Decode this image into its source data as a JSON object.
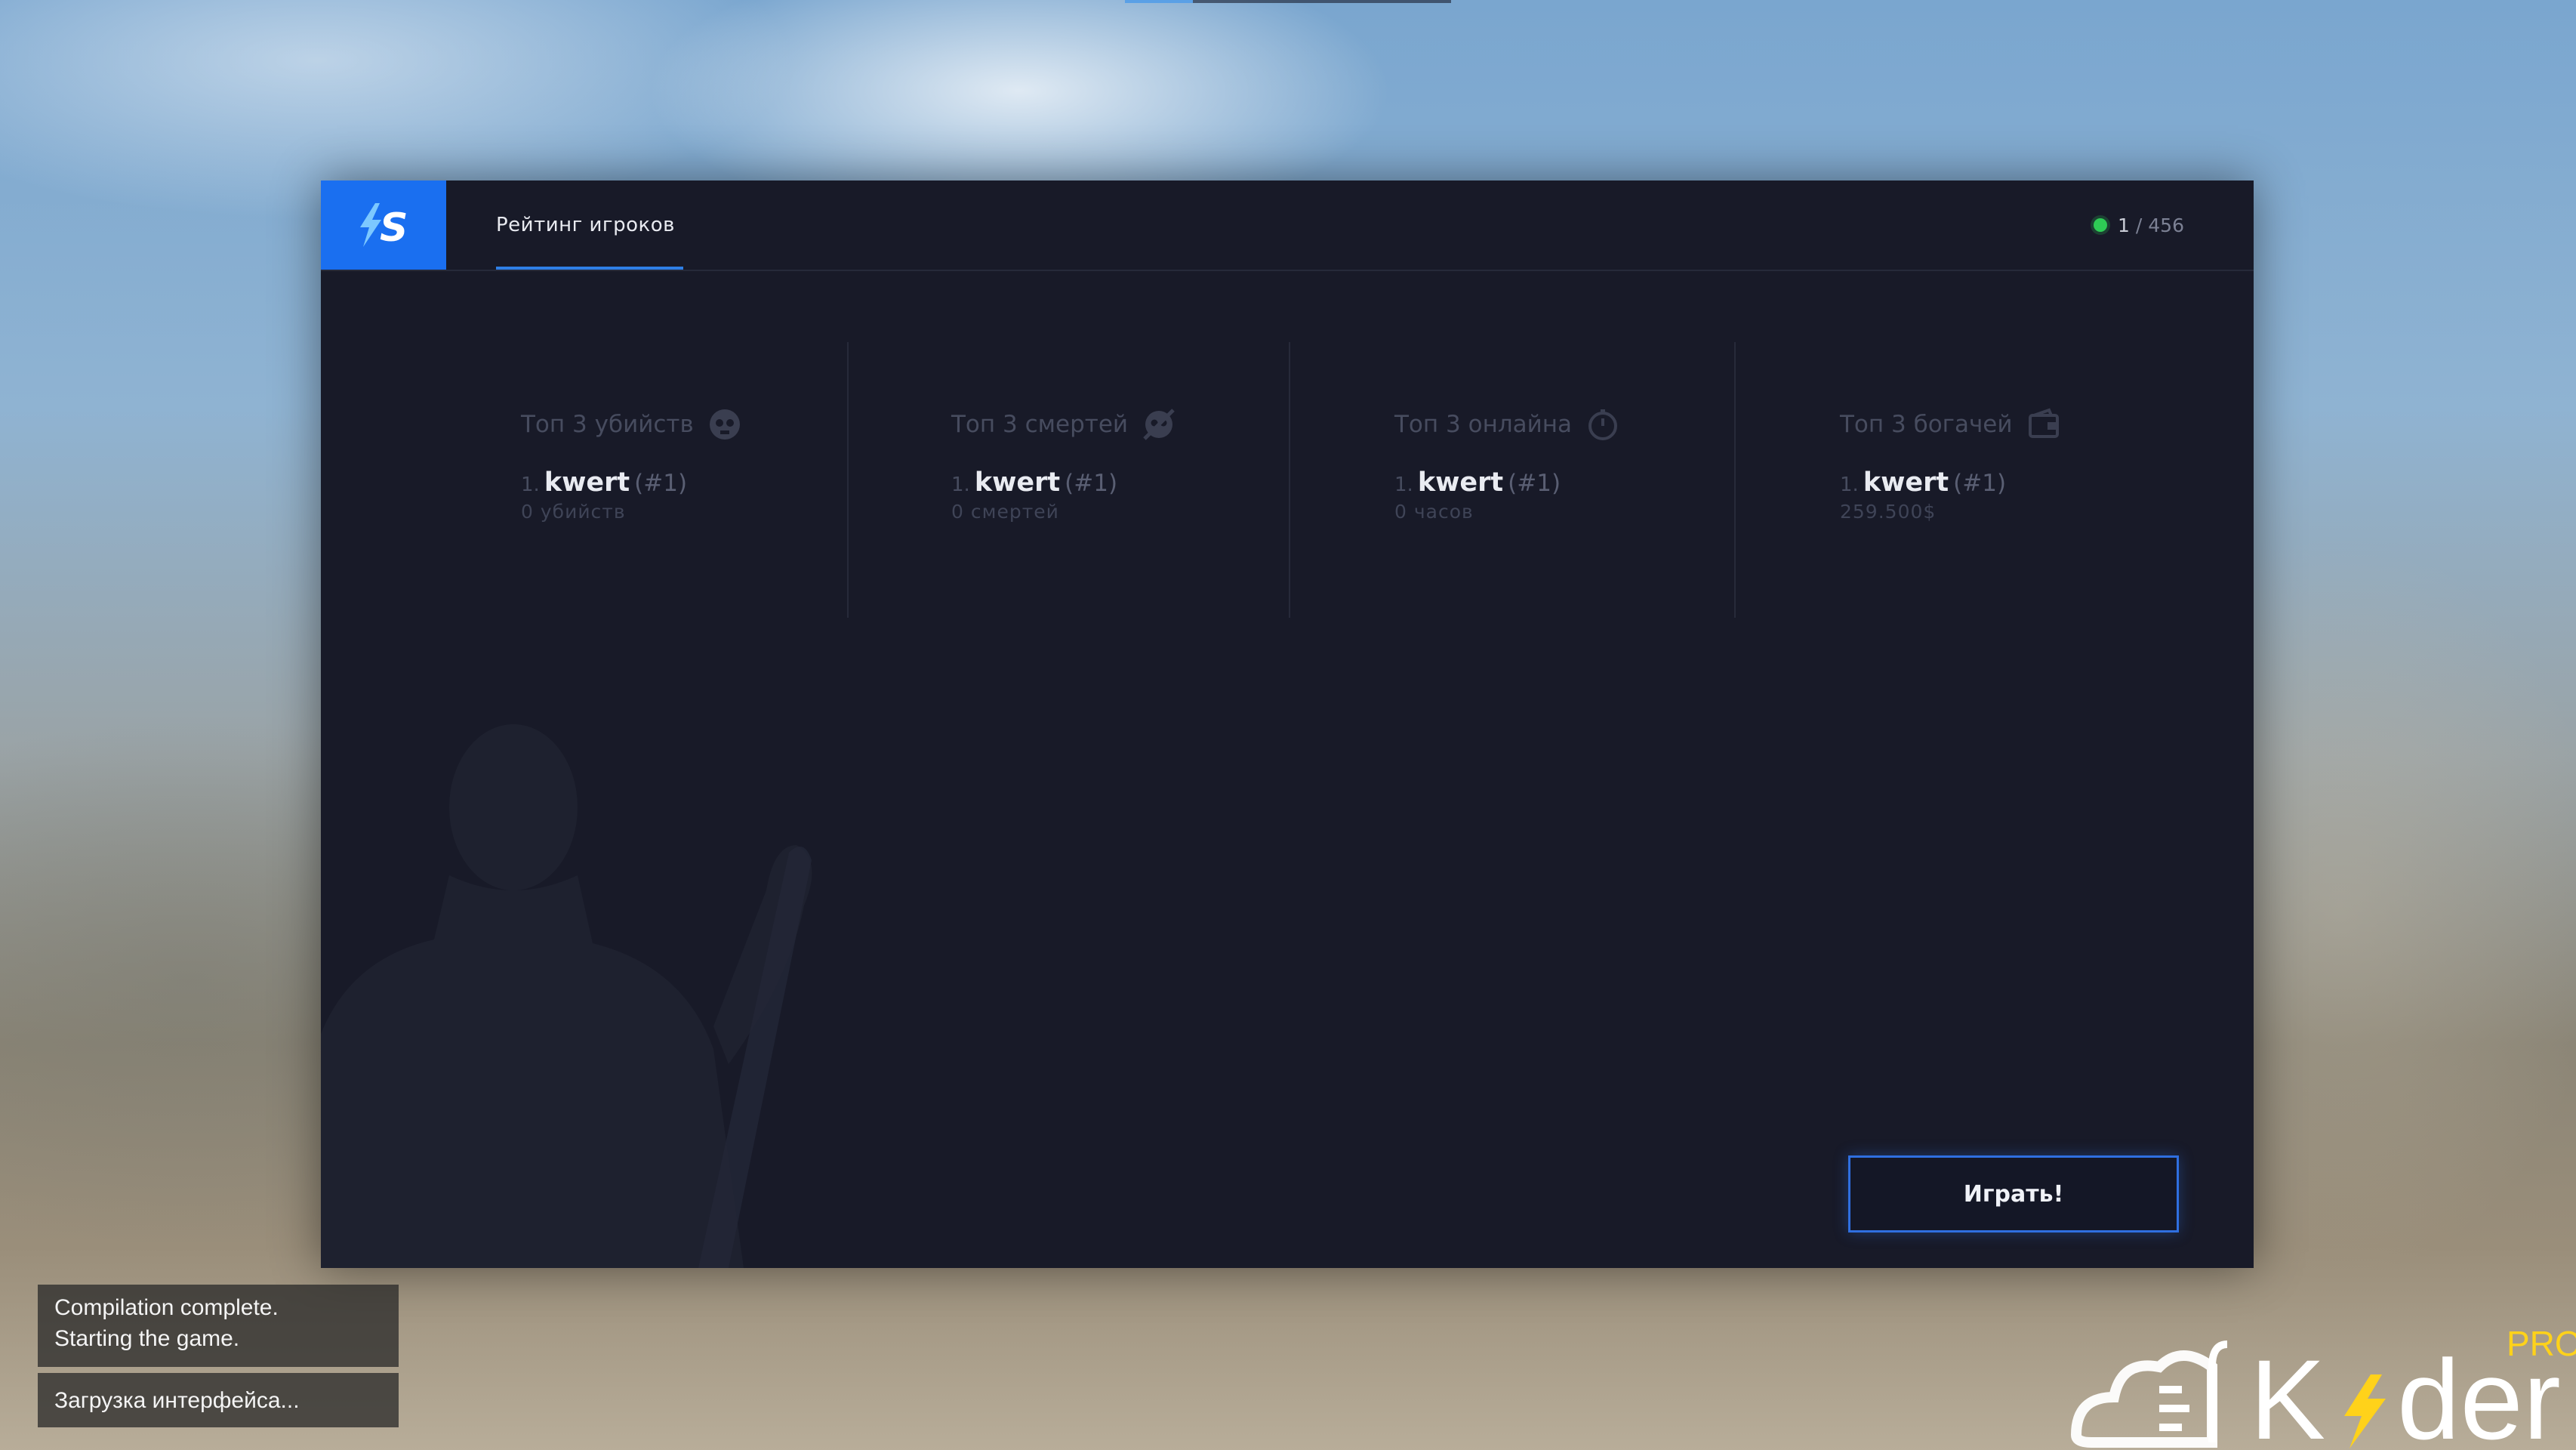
{
  "header": {
    "tab_label": "Рейтинг игроков",
    "online_current": "1",
    "online_separator": "/",
    "online_max": "456"
  },
  "stats": [
    {
      "title": "Топ 3 убийств",
      "icon": "skull-icon",
      "rank": "1.",
      "player": "kwert",
      "tag": "(#1)",
      "value": "0 убийств"
    },
    {
      "title": "Топ 3 смертей",
      "icon": "crossed-skull-icon",
      "rank": "1.",
      "player": "kwert",
      "tag": "(#1)",
      "value": "0 смертей"
    },
    {
      "title": "Топ 3 онлайна",
      "icon": "timer-icon",
      "rank": "1.",
      "player": "kwert",
      "tag": "(#1)",
      "value": "0 часов"
    },
    {
      "title": "Топ 3 богачей",
      "icon": "wallet-icon",
      "rank": "1.",
      "player": "kwert",
      "tag": "(#1)",
      "value": "259.500$"
    }
  ],
  "play_button": {
    "label": "Играть!"
  },
  "toasts": {
    "compile_line1": "Compilation complete.",
    "compile_line2": "Starting the game.",
    "loading": "Загрузка интерфейса..."
  },
  "watermark": {
    "text": "K",
    "text2": "der",
    "badge": "PRO"
  },
  "colors": {
    "accent": "#1a6ff0",
    "online": "#2ecc55",
    "panel": "#181a28"
  }
}
